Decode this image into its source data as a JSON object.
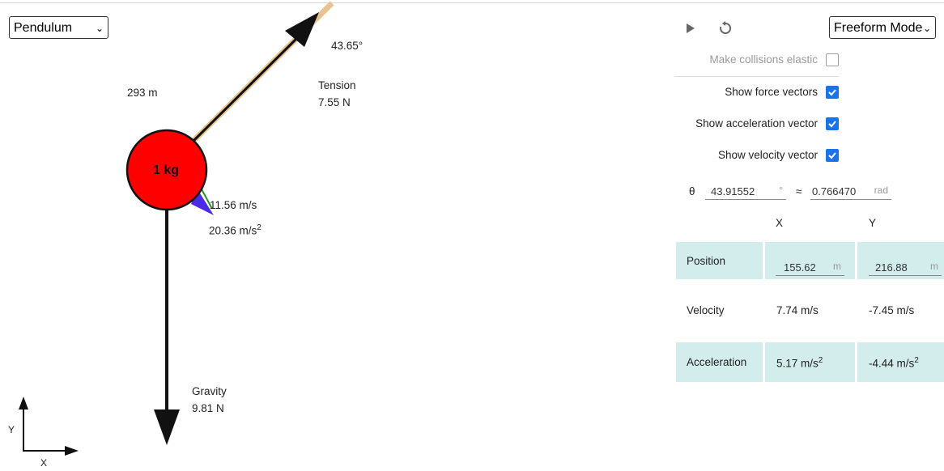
{
  "mode_select": {
    "value": "Pendulum"
  },
  "freeform_select": {
    "value": "Freeform Mode"
  },
  "scene": {
    "angle_label": "43.65°",
    "length_label": "293 m",
    "mass_label": "1 kg",
    "tension_title": "Tension",
    "tension_value": "7.55 N",
    "velocity_label": "11.56 m/s",
    "acceleration_value": "20.36 m/s",
    "acceleration_exp": "2",
    "gravity_title": "Gravity",
    "gravity_value": "9.81 N",
    "axis_y": "Y",
    "axis_x": "X",
    "colors": {
      "ball": "#ff0000",
      "rod": "#e8c392",
      "acceleration": "#4b2be8",
      "velocity": "#2e8b2e"
    }
  },
  "controls": {
    "play_icon": "play-icon",
    "reset_icon": "reset-icon",
    "elastic_label": "Make collisions elastic",
    "elastic_checked": false,
    "force_label": "Show force vectors",
    "force_checked": true,
    "accel_label": "Show acceleration vector",
    "accel_checked": true,
    "velocity_label": "Show velocity vector",
    "velocity_checked": true
  },
  "theta": {
    "symbol": "θ",
    "deg_value": "43.91552",
    "deg_unit": "°",
    "approx": "≈",
    "rad_value": "0.766470",
    "rad_unit": "rad"
  },
  "table": {
    "col_x": "X",
    "col_y": "Y",
    "position_label": "Position",
    "position_x": "155.62",
    "position_y": "216.88",
    "position_unit": "m",
    "velocity_label": "Velocity",
    "velocity_x": "7.74 m/s",
    "velocity_y": "-7.45 m/s",
    "acceleration_label": "Acceleration",
    "acceleration_x": "5.17 m/s",
    "acceleration_y": "-4.44 m/s",
    "acceleration_exp": "2"
  }
}
